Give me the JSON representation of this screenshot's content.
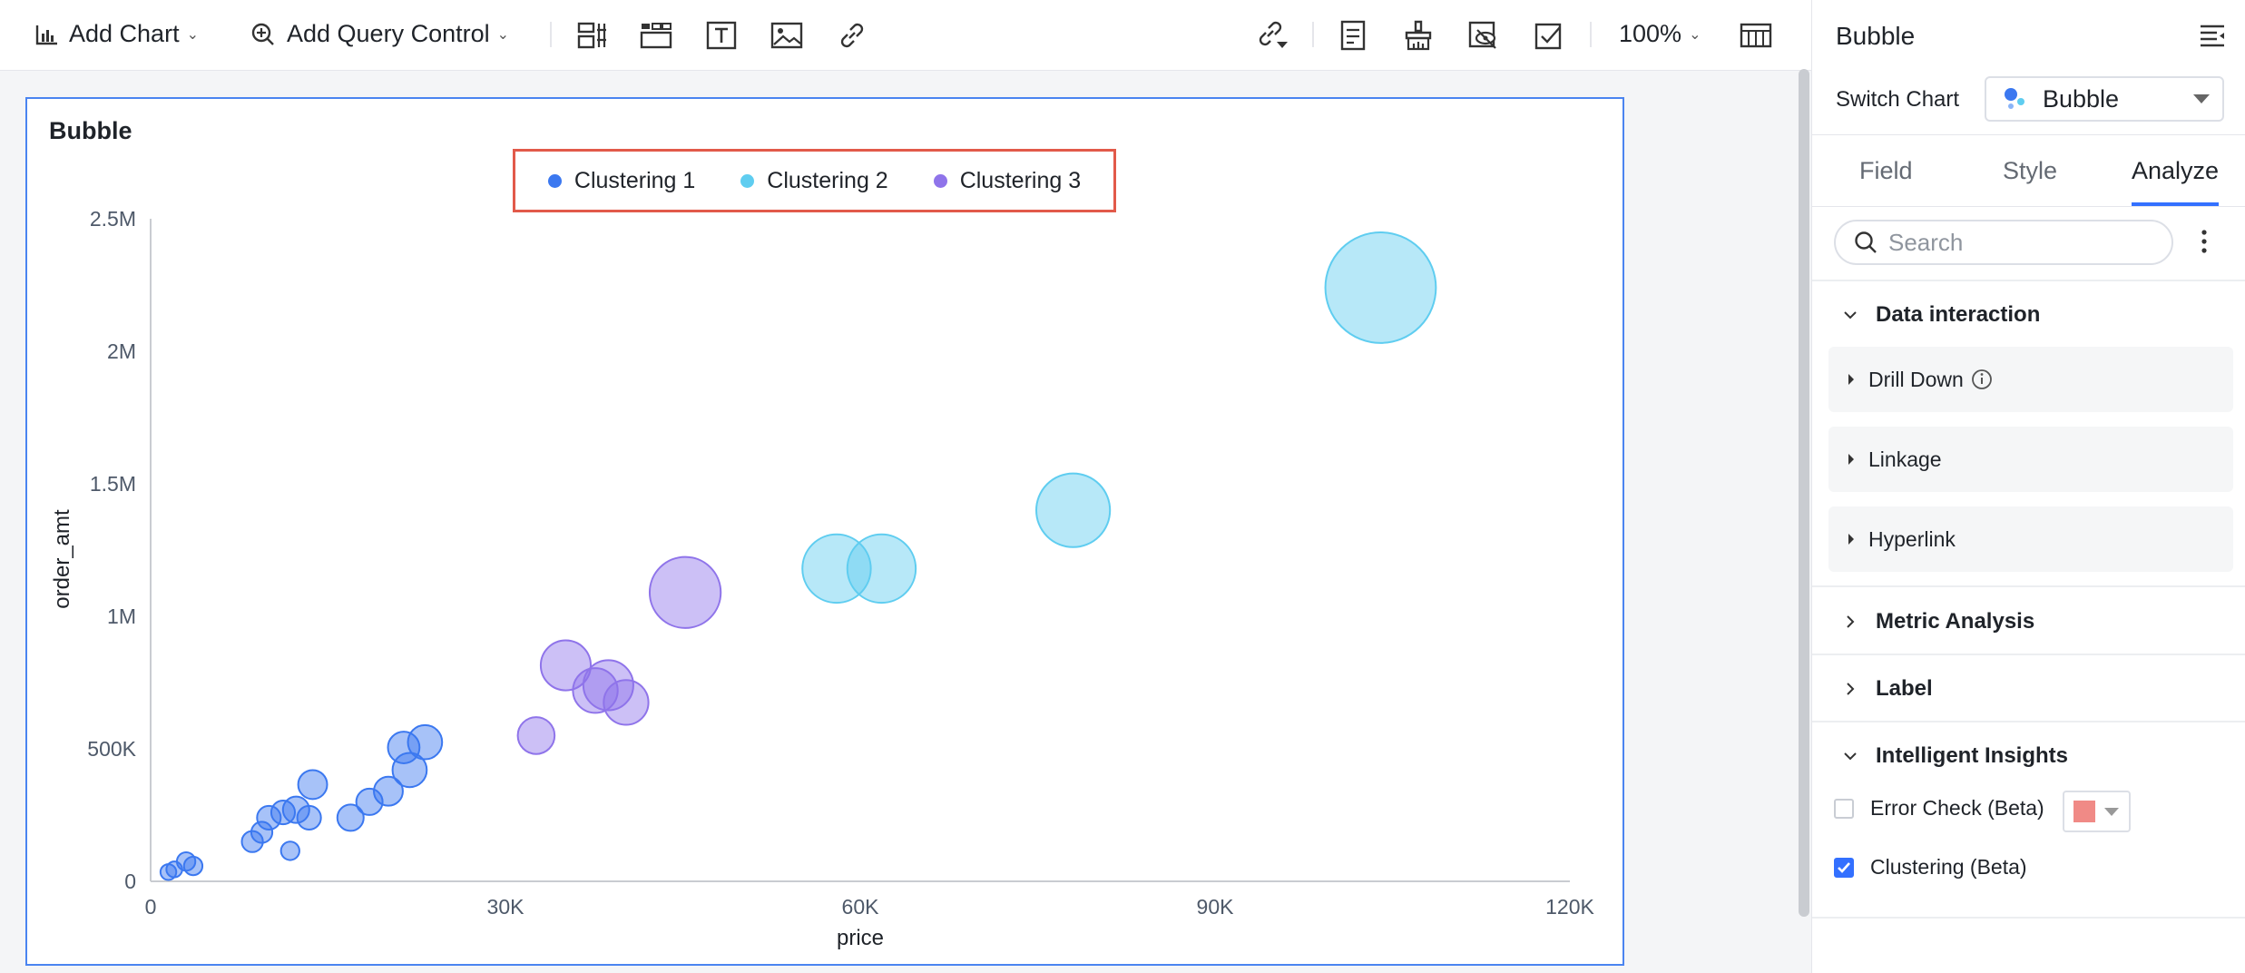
{
  "toolbar": {
    "add_chart": "Add Chart",
    "add_query_control": "Add Query Control",
    "zoom": "100%"
  },
  "chart": {
    "title": "Bubble"
  },
  "chart_data": {
    "type": "scatter",
    "title": "Bubble",
    "xlabel": "price",
    "ylabel": "order_amt",
    "xlim": [
      0,
      120000
    ],
    "ylim": [
      0,
      2500000
    ],
    "x_ticks": [
      "0",
      "30K",
      "60K",
      "90K",
      "120K"
    ],
    "y_ticks": [
      "0",
      "500K",
      "1M",
      "1.5M",
      "2M",
      "2.5M"
    ],
    "grid": "horizontal",
    "legend": "top-center",
    "series": [
      {
        "name": "Clustering 1",
        "color": "#3b78f0",
        "points": [
          {
            "x": 1500,
            "y": 35000,
            "size": 6
          },
          {
            "x": 2000,
            "y": 45000,
            "size": 6
          },
          {
            "x": 3000,
            "y": 75000,
            "size": 7
          },
          {
            "x": 3600,
            "y": 58000,
            "size": 7
          },
          {
            "x": 8600,
            "y": 150000,
            "size": 8
          },
          {
            "x": 9400,
            "y": 185000,
            "size": 8
          },
          {
            "x": 10000,
            "y": 240000,
            "size": 9
          },
          {
            "x": 11200,
            "y": 260000,
            "size": 9
          },
          {
            "x": 11800,
            "y": 115000,
            "size": 7
          },
          {
            "x": 12300,
            "y": 270000,
            "size": 10
          },
          {
            "x": 13400,
            "y": 240000,
            "size": 9
          },
          {
            "x": 13700,
            "y": 365000,
            "size": 11
          },
          {
            "x": 16900,
            "y": 240000,
            "size": 10
          },
          {
            "x": 18500,
            "y": 300000,
            "size": 10
          },
          {
            "x": 20100,
            "y": 340000,
            "size": 11
          },
          {
            "x": 21400,
            "y": 505000,
            "size": 12
          },
          {
            "x": 21900,
            "y": 420000,
            "size": 13
          },
          {
            "x": 23200,
            "y": 525000,
            "size": 13
          }
        ]
      },
      {
        "name": "Clustering 2",
        "color": "#5fcdf0",
        "points": [
          {
            "x": 58000,
            "y": 1180000,
            "size": 26
          },
          {
            "x": 61800,
            "y": 1180000,
            "size": 26
          },
          {
            "x": 78000,
            "y": 1400000,
            "size": 28
          },
          {
            "x": 104000,
            "y": 2240000,
            "size": 42
          }
        ]
      },
      {
        "name": "Clustering 3",
        "color": "#8f74ea",
        "points": [
          {
            "x": 32600,
            "y": 550000,
            "size": 14
          },
          {
            "x": 35100,
            "y": 815000,
            "size": 19
          },
          {
            "x": 37600,
            "y": 720000,
            "size": 17
          },
          {
            "x": 38700,
            "y": 740000,
            "size": 19
          },
          {
            "x": 40200,
            "y": 675000,
            "size": 17
          },
          {
            "x": 45200,
            "y": 1090000,
            "size": 27
          }
        ]
      }
    ]
  },
  "panel": {
    "title": "Bubble",
    "switch_label": "Switch Chart",
    "switch_value": "Bubble",
    "tabs": [
      "Field",
      "Style",
      "Analyze"
    ],
    "search_placeholder": "Search",
    "data_interaction": "Data interaction",
    "drill_down": "Drill Down",
    "linkage": "Linkage",
    "hyperlink": "Hyperlink",
    "metric_analysis": "Metric Analysis",
    "label": "Label",
    "intelligent_insights": "Intelligent Insights",
    "error_check": "Error Check (Beta)",
    "error_check_checked": false,
    "error_check_color": "#f08a86",
    "clustering": "Clustering (Beta)",
    "clustering_checked": true
  }
}
